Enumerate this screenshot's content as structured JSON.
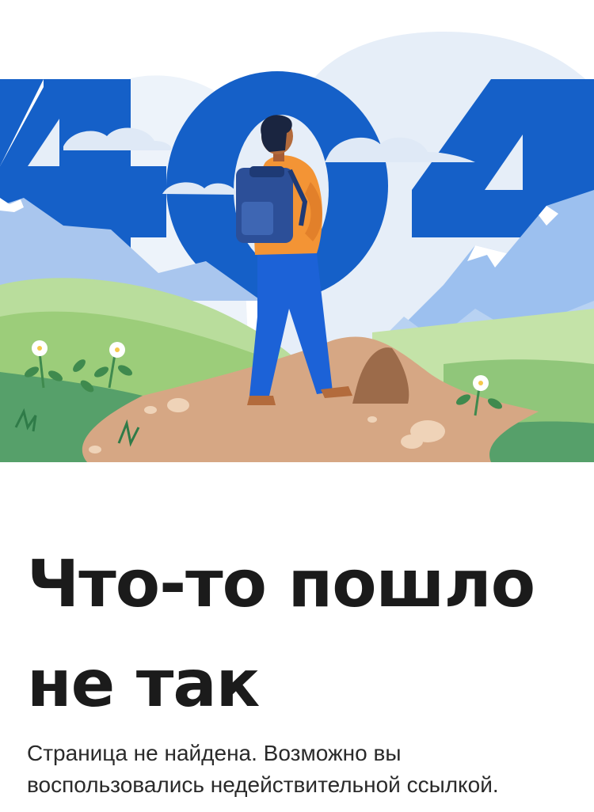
{
  "error_page": {
    "title": "Что-то пошло не так",
    "message": "Страница не найдена. Возможно вы воспользовались недействительной ссылкой."
  },
  "illustration": {
    "name": "404 hiker illustration",
    "colors": {
      "digits": "#1560c8",
      "sky": "#e4edf7",
      "mountains": "#9cc0ef",
      "grass": "#8cc875",
      "path": "#d4a785",
      "jacket": "#f39435",
      "backpack": "#2c4f98",
      "pants": "#1c62d7"
    }
  }
}
